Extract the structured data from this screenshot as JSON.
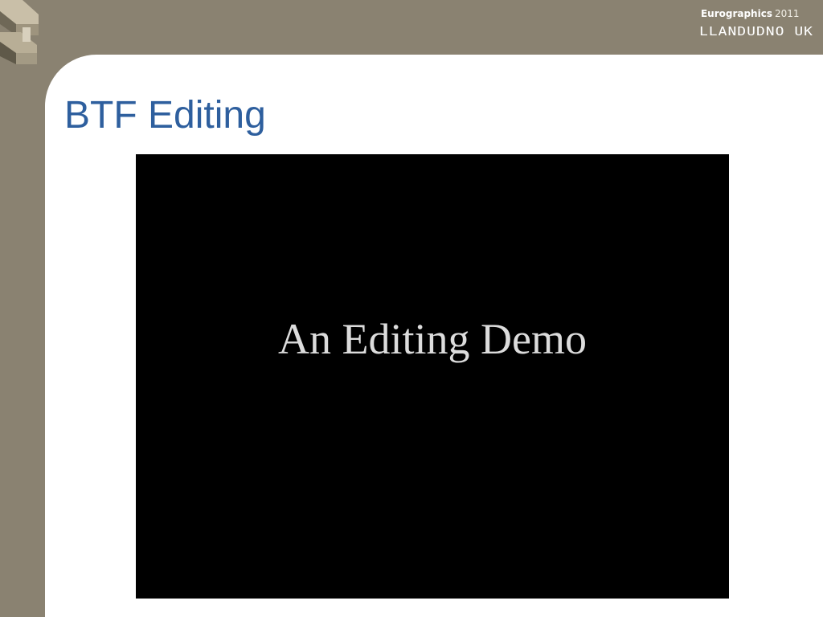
{
  "header": {
    "brand_name": "Eurographics",
    "brand_year": "2011",
    "location": "LLANDUDNO UK",
    "logo_icon": "eurographics-logo-icon"
  },
  "slide": {
    "title": "BTF Editing",
    "video": {
      "caption": "An Editing Demo"
    }
  },
  "colors": {
    "banner": "#8a8271",
    "title": "#2e5f9e",
    "content_background": "#ffffff",
    "video_background": "#000000",
    "caption_text": "#dcdcdc"
  }
}
